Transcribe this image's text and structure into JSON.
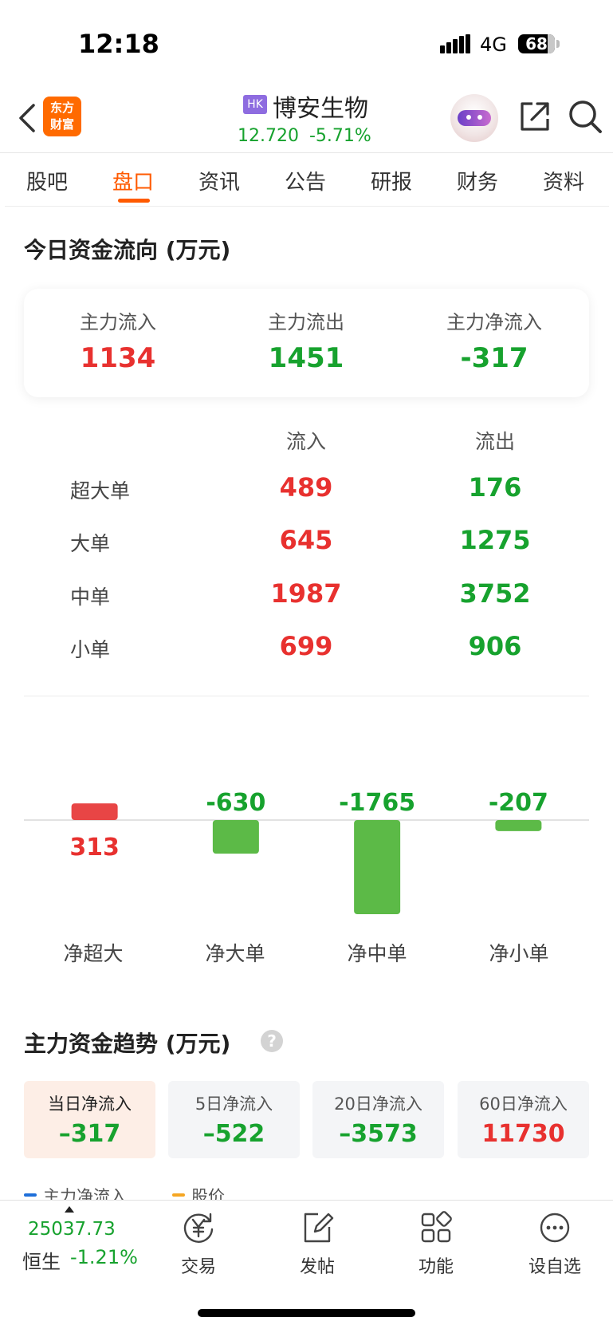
{
  "status_bar": {
    "time": "12:18",
    "network": "4G",
    "battery": "68"
  },
  "header": {
    "logo_text_line1": "东方",
    "logo_text_line2": "财富",
    "market_badge": "HK",
    "stock_name": "博安生物",
    "price": "12.720",
    "change_pct": "-5.71%"
  },
  "tabs": [
    {
      "label": "股吧"
    },
    {
      "label": "盘口",
      "active": true
    },
    {
      "label": "资讯"
    },
    {
      "label": "公告"
    },
    {
      "label": "研报"
    },
    {
      "label": "财务"
    },
    {
      "label": "资料"
    }
  ],
  "fund_flow": {
    "title": "今日资金流向 (万元)",
    "summary": {
      "inflow_label": "主力流入",
      "inflow_value": "1134",
      "outflow_label": "主力流出",
      "outflow_value": "1451",
      "net_label": "主力净流入",
      "net_value": "-317"
    },
    "col_in": "流入",
    "col_out": "流出",
    "rows": [
      {
        "label": "超大单",
        "in": "489",
        "out": "176"
      },
      {
        "label": "大单",
        "in": "645",
        "out": "1275"
      },
      {
        "label": "中单",
        "in": "1987",
        "out": "3752"
      },
      {
        "label": "小单",
        "in": "699",
        "out": "906"
      }
    ]
  },
  "chart_data": {
    "type": "bar",
    "categories": [
      "净超大",
      "净大单",
      "净中单",
      "净小单"
    ],
    "values": [
      313,
      -630,
      -1765,
      -207
    ],
    "positive_color": "#e84545",
    "negative_color": "#5cba47"
  },
  "trend": {
    "title": "主力资金趋势 (万元)",
    "help_icon": "?",
    "tabs": [
      {
        "label": "当日净流入",
        "value": "–317",
        "color": "green",
        "active": true
      },
      {
        "label": "5日净流入",
        "value": "–522",
        "color": "green"
      },
      {
        "label": "20日净流入",
        "value": "–3573",
        "color": "green"
      },
      {
        "label": "60日净流入",
        "value": "11730",
        "color": "red"
      }
    ],
    "legend": [
      {
        "label": "主力净流入",
        "color": "#1e6fd9"
      },
      {
        "label": "股价",
        "color": "#f5a623"
      }
    ]
  },
  "bottom_bar": {
    "index_value": "25037.73",
    "index_name": "恒生",
    "index_change": "-1.21%",
    "nav": [
      {
        "label": "交易",
        "icon": "yen-refresh-icon"
      },
      {
        "label": "发帖",
        "icon": "edit-post-icon"
      },
      {
        "label": "功能",
        "icon": "grid-icon"
      },
      {
        "label": "设自选",
        "icon": "more-dots-icon"
      }
    ]
  }
}
